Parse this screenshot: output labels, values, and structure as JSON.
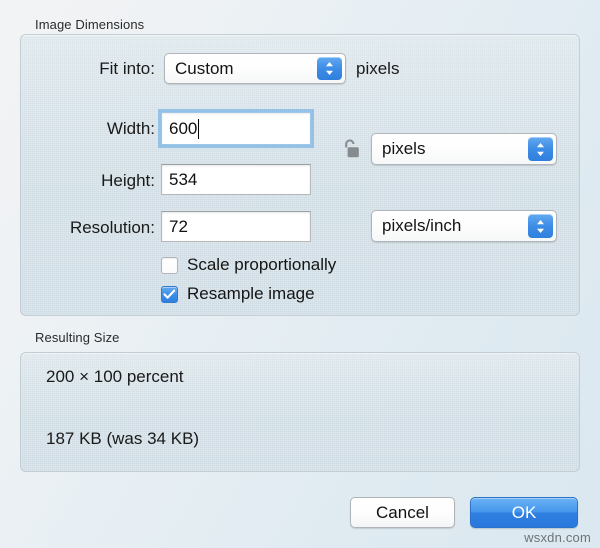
{
  "dialog": {
    "sections": {
      "image_dimensions": {
        "caption": "Image Dimensions",
        "fit_into": {
          "label": "Fit into:",
          "value": "Custom",
          "suffix": "pixels",
          "options": [
            "Custom"
          ]
        },
        "width": {
          "label": "Width:",
          "value": "600",
          "focused": true
        },
        "height": {
          "label": "Height:",
          "value": "534"
        },
        "resolution": {
          "label": "Resolution:",
          "value": "72"
        },
        "size_unit": {
          "value": "pixels",
          "options": [
            "pixels"
          ]
        },
        "resolution_unit": {
          "value": "pixels/inch",
          "options": [
            "pixels/inch"
          ]
        },
        "lock": {
          "state": "unlocked",
          "icon": "open-padlock-icon"
        },
        "checkboxes": [
          {
            "label": "Scale proportionally",
            "checked": false
          },
          {
            "label": "Resample image",
            "checked": true
          }
        ]
      },
      "resulting_size": {
        "caption": "Resulting Size",
        "percent_line": "200 × 100 percent",
        "filesize_line": "187 KB (was 34 KB)"
      }
    },
    "buttons": {
      "cancel": "Cancel",
      "ok": "OK"
    },
    "watermark": "wsxdn.com",
    "colors": {
      "accent_blue": "#3d8de6",
      "group_background": "#cfdce3",
      "window_background": "#e6eef3",
      "focus_ring": "#78b4e4"
    }
  }
}
